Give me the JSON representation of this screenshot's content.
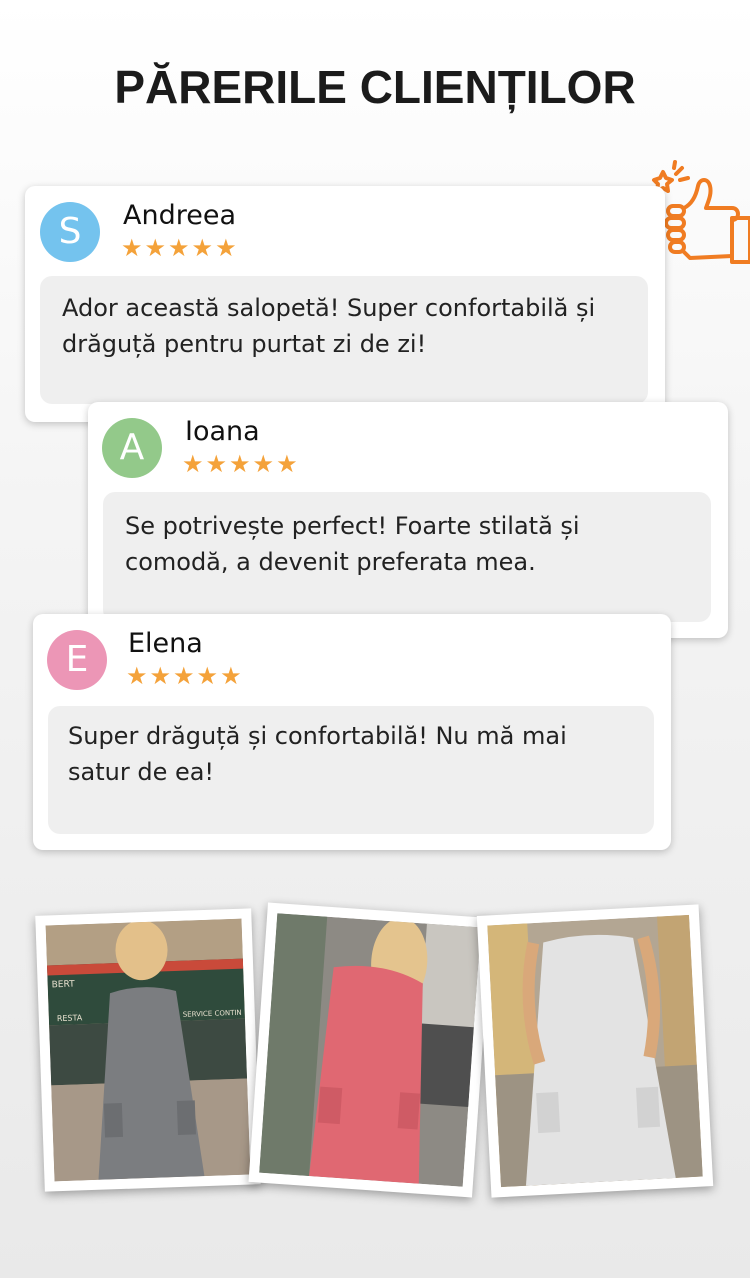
{
  "title": "PĂRERILE CLIENȚILOR",
  "reviews": [
    {
      "initial": "S",
      "name": "Andreea",
      "stars": "★★★★★",
      "text": "Ador această salopetă! Super confortabilă și drăguță pentru purtat zi de zi!",
      "avatar_color": "#74c3ee"
    },
    {
      "initial": "A",
      "name": "Ioana",
      "stars": "★★★★★",
      "text": "Se potrivește perfect! Foarte stilată și comodă, a devenit preferata mea.",
      "avatar_color": "#93c98a"
    },
    {
      "initial": "E",
      "name": "Elena",
      "stars": "★★★★★",
      "text": "Super drăguță și confortabilă! Nu mă mai satur de ea!",
      "avatar_color": "#ec96b6"
    }
  ],
  "photos": [
    {
      "icon": "grey-jumpsuit-photo",
      "color": "#7b7d80",
      "sign1": "BERT",
      "sign2": "RESTA",
      "sign3": "SERVICE CONTIN"
    },
    {
      "icon": "coral-jumpsuit-photo",
      "color": "#e06872"
    },
    {
      "icon": "white-jumpsuit-photo",
      "color": "#e3e3e3"
    }
  ],
  "accent_color": "#f07c22"
}
